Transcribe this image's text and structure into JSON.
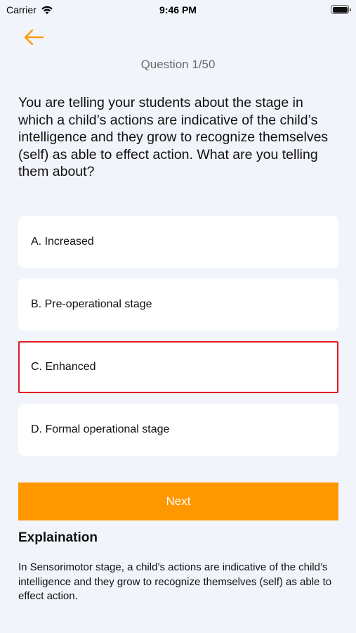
{
  "status_bar": {
    "carrier": "Carrier",
    "time": "9:46 PM"
  },
  "colors": {
    "accent": "#ff9800",
    "selected_border": "#e0191e",
    "background": "#f2f4fb"
  },
  "header": {
    "back_icon": "arrow-left-icon",
    "counter": "Question 1/50"
  },
  "question": {
    "text": "You are telling your students about the stage in which a child’s actions are indicative of the child’s intelligence and they grow to recognize themselves (self) as able to effect action. What are you telling them about?"
  },
  "options": [
    {
      "label": "A. Increased"
    },
    {
      "label": "B. Pre-operational stage"
    },
    {
      "label": "C. Enhanced"
    },
    {
      "label": "D. Formal operational stage"
    }
  ],
  "next_button": {
    "label": "Next"
  },
  "explanation": {
    "title": "Explaination",
    "text": "In Sensorimotor stage, a child’s actions are indicative of the child’s intelligence and they grow to recognize themselves (self) as able to effect action."
  }
}
